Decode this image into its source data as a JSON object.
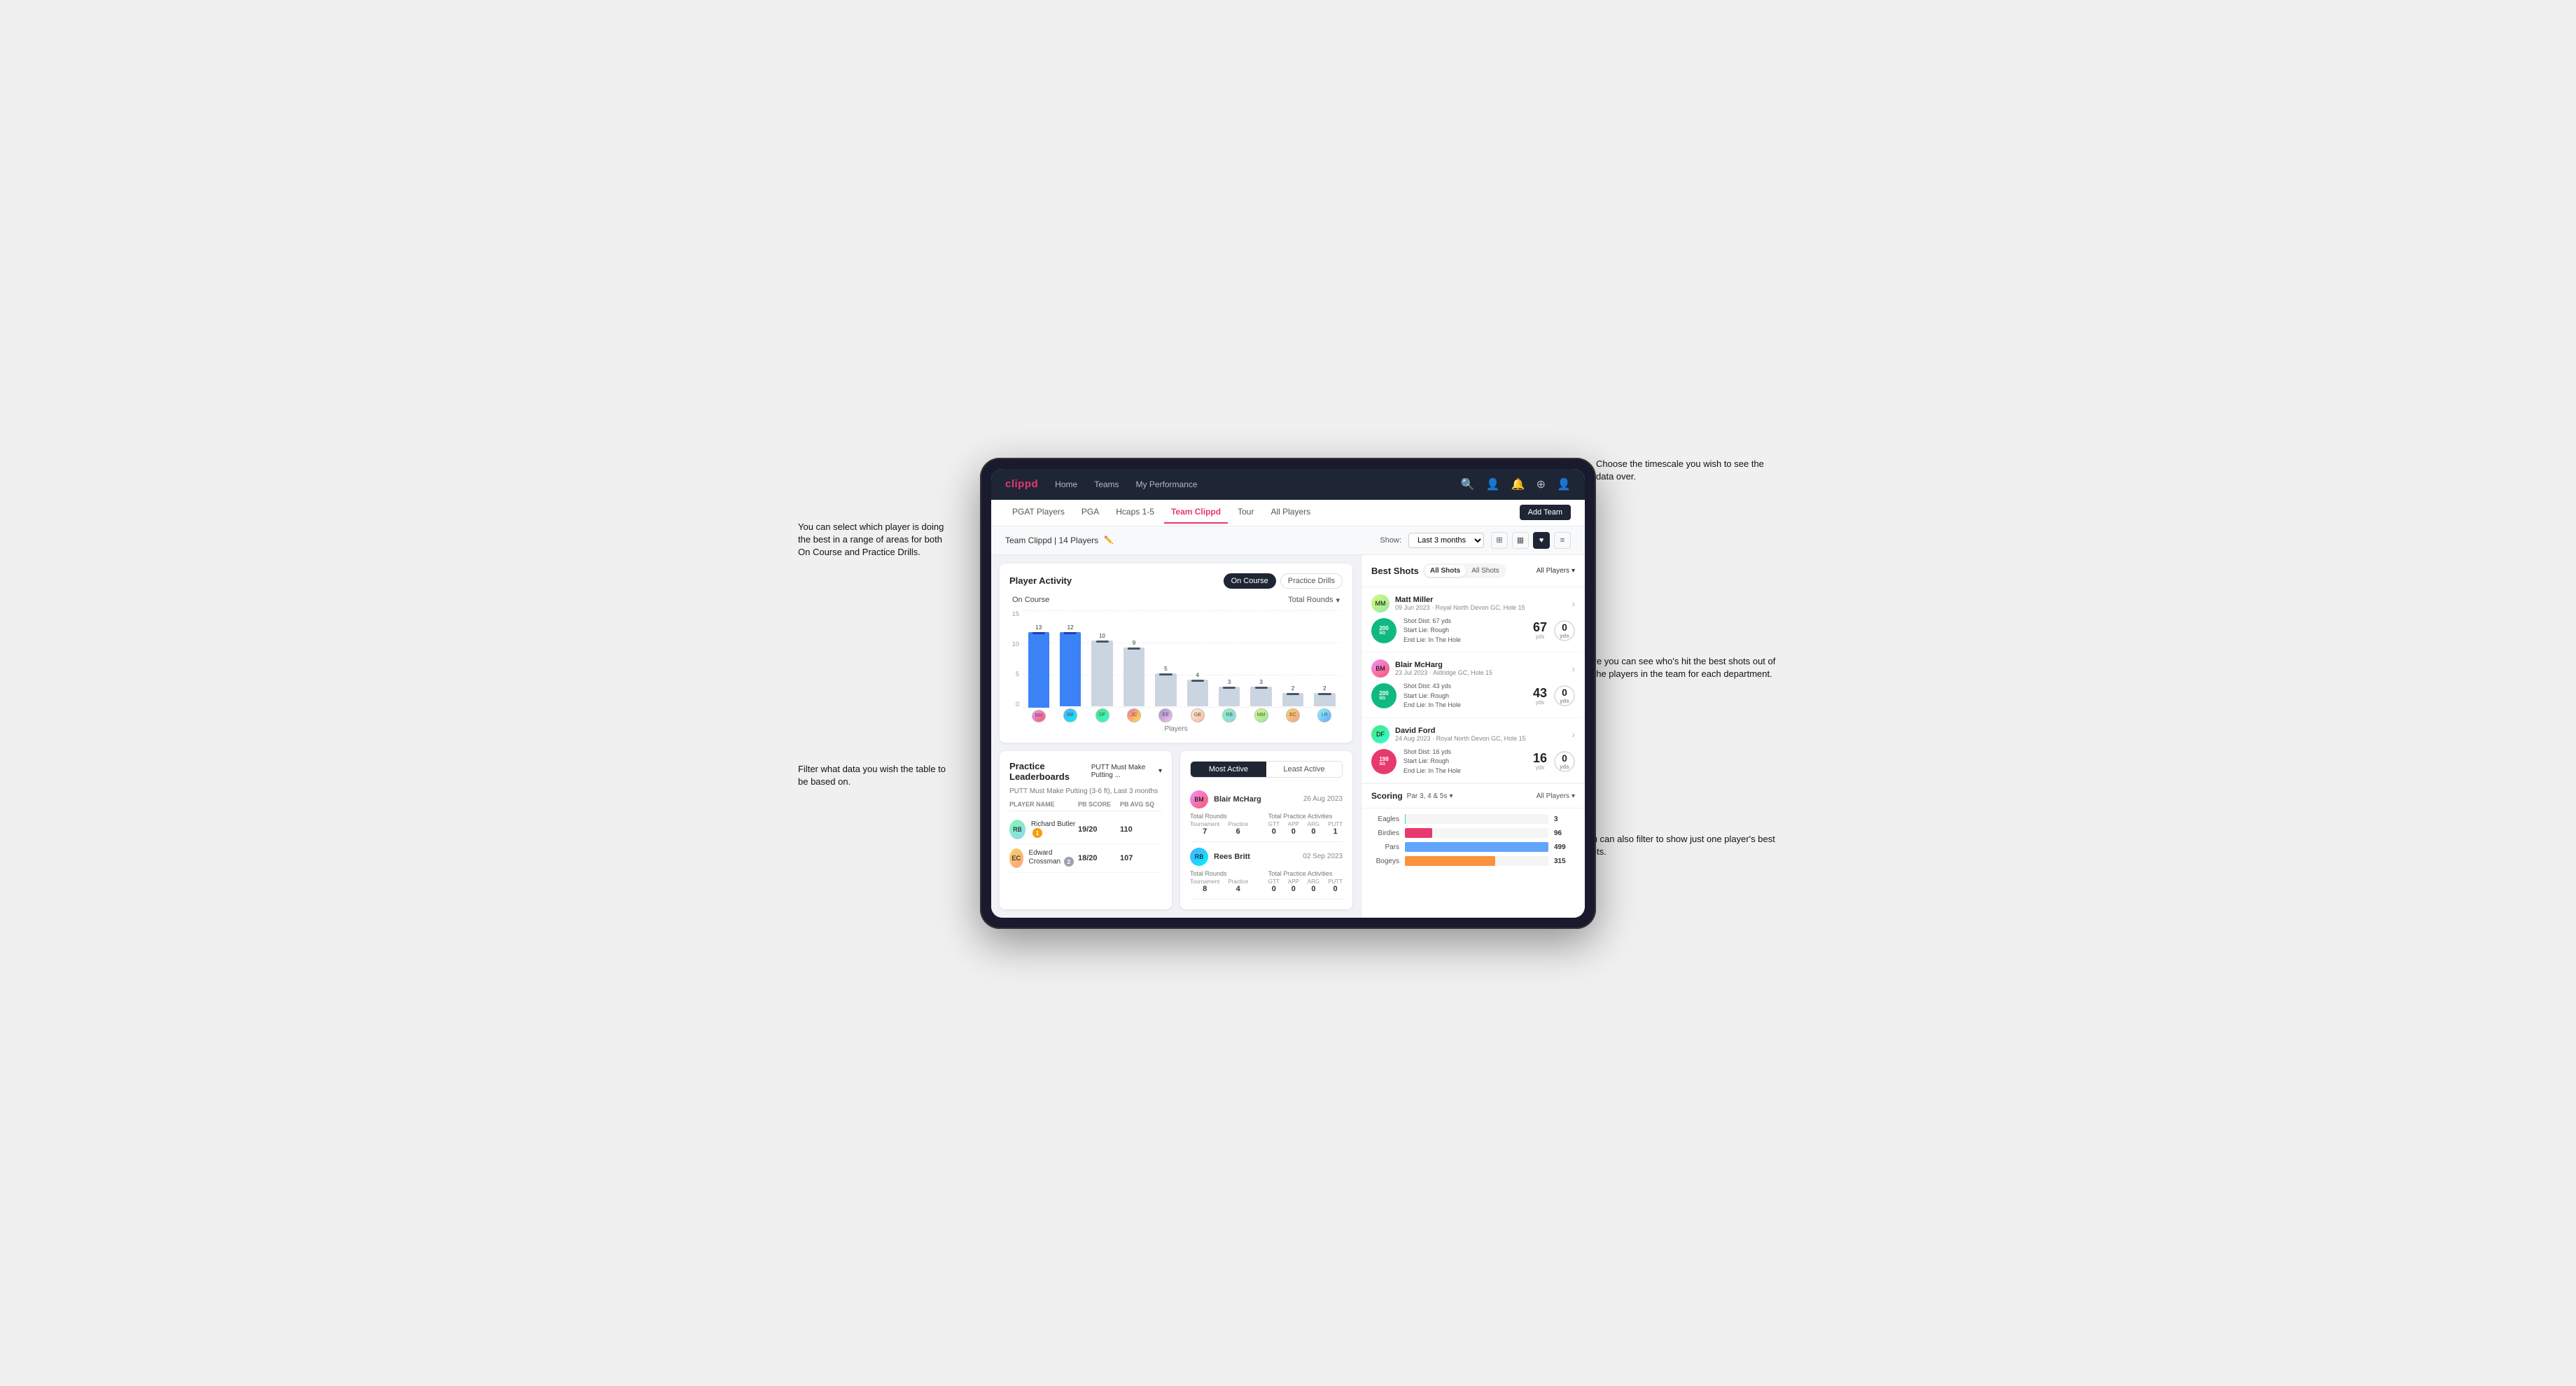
{
  "annotations": {
    "top_right": "Choose the timescale you wish to see the data over.",
    "top_left": "You can select which player is doing the best in a range of areas for both On Course and Practice Drills.",
    "bottom_left": "Filter what data you wish the table to be based on.",
    "mid_right": "Here you can see who's hit the best shots out of all the players in the team for each department.",
    "bottom_right": "You can also filter to show just one player's best shots."
  },
  "nav": {
    "brand": "clippd",
    "items": [
      "Home",
      "Teams",
      "My Performance"
    ]
  },
  "sub_nav": {
    "items": [
      "PGAT Players",
      "PGA",
      "Hcaps 1-5",
      "Team Clippd",
      "Tour",
      "All Players"
    ],
    "active": "Team Clippd",
    "add_button": "Add Team"
  },
  "team_header": {
    "title": "Team Clippd | 14 Players",
    "show_label": "Show:",
    "show_value": "Last 3 months",
    "views": [
      "grid-4",
      "grid-3",
      "heart",
      "list"
    ]
  },
  "player_activity": {
    "title": "Player Activity",
    "tabs": [
      "On Course",
      "Practice Drills"
    ],
    "active_tab": "On Course",
    "chart_label": "On Course",
    "filter_label": "Total Rounds",
    "y_axis_label": "Total Rounds",
    "y_labels": [
      "15",
      "10",
      "5",
      "0"
    ],
    "bars": [
      {
        "name": "B. McHarg",
        "value": 13,
        "pct": 87,
        "avatar": "1"
      },
      {
        "name": "B. Britt",
        "value": 12,
        "pct": 80,
        "avatar": "2"
      },
      {
        "name": "D. Ford",
        "value": 10,
        "pct": 67,
        "avatar": "3"
      },
      {
        "name": "J. Coles",
        "value": 9,
        "pct": 60,
        "avatar": "4"
      },
      {
        "name": "E. Ebert",
        "value": 5,
        "pct": 33,
        "avatar": "5"
      },
      {
        "name": "G. Billingham",
        "value": 4,
        "pct": 27,
        "avatar": "6"
      },
      {
        "name": "R. Butler",
        "value": 3,
        "pct": 20,
        "avatar": "7"
      },
      {
        "name": "M. Miller",
        "value": 3,
        "pct": 20,
        "avatar": "8"
      },
      {
        "name": "E. Crossman",
        "value": 2,
        "pct": 13,
        "avatar": "9"
      },
      {
        "name": "L. Robertson",
        "value": 2,
        "pct": 13,
        "avatar": "10"
      }
    ],
    "x_label": "Players"
  },
  "practice_leaderboards": {
    "title": "Practice Leaderboards",
    "filter": "PUTT Must Make Putting ...",
    "subtitle": "PUTT Must Make Putting (3-6 ft), Last 3 months",
    "columns": [
      "Player Name",
      "PB Score",
      "PB Avg SQ"
    ],
    "rows": [
      {
        "name": "Richard Butler",
        "badge": "1",
        "badge_type": "gold",
        "pb_score": "19/20",
        "pb_avg": "110"
      },
      {
        "name": "Edward Crossman",
        "badge": "2",
        "badge_type": "silver",
        "pb_score": "18/20",
        "pb_avg": "107"
      }
    ]
  },
  "most_active": {
    "tabs": [
      "Most Active",
      "Least Active"
    ],
    "active_tab": "Most Active",
    "players": [
      {
        "name": "Blair McHarg",
        "date": "26 Aug 2023",
        "total_rounds_label": "Total Rounds",
        "tournament": "7",
        "practice": "6",
        "total_practice_label": "Total Practice Activities",
        "gtt": "0",
        "app": "0",
        "arg": "0",
        "putt": "1"
      },
      {
        "name": "Rees Britt",
        "date": "02 Sep 2023",
        "total_rounds_label": "Total Rounds",
        "tournament": "8",
        "practice": "4",
        "total_practice_label": "Total Practice Activities",
        "gtt": "0",
        "app": "0",
        "arg": "0",
        "putt": "0"
      }
    ]
  },
  "best_shots": {
    "title": "Best Shots",
    "toggles": [
      "All Shots",
      "All Shots"
    ],
    "active_toggle": "All Shots",
    "players_label": "All Players",
    "shots": [
      {
        "player": "Matt Miller",
        "date": "09 Jun 2023",
        "course": "Royal North Devon GC",
        "hole": "Hole 15",
        "badge": "200",
        "badge_class": "green",
        "description": "Shot Dist: 67 yds\nStart Lie: Rough\nEnd Lie: In The Hole",
        "distance": "67",
        "dist_unit": "yds",
        "carry": "0",
        "carry_unit": "yds"
      },
      {
        "player": "Blair McHarg",
        "date": "23 Jul 2023",
        "course": "Aldridge GC",
        "hole": "Hole 15",
        "badge": "200",
        "badge_class": "green",
        "description": "Shot Dist: 43 yds\nStart Lie: Rough\nEnd Lie: In The Hole",
        "distance": "43",
        "dist_unit": "yds",
        "carry": "0",
        "carry_unit": "yds"
      },
      {
        "player": "David Ford",
        "date": "24 Aug 2023",
        "course": "Royal North Devon GC",
        "hole": "Hole 15",
        "badge": "198",
        "badge_class": "green",
        "description": "Shot Dist: 16 yds\nStart Lie: Rough\nEnd Lie: In The Hole",
        "distance": "16",
        "dist_unit": "yds",
        "carry": "0",
        "carry_unit": "yds"
      }
    ]
  },
  "scoring": {
    "title": "Scoring",
    "filter1": "Par 3, 4 & 5s",
    "filter2": "All Players",
    "rows": [
      {
        "label": "Eagles",
        "value": 3,
        "max": 500,
        "bar_class": "bar-eagles",
        "pct": 0.6
      },
      {
        "label": "Birdies",
        "value": 96,
        "max": 500,
        "bar_class": "bar-birdies",
        "pct": 19
      },
      {
        "label": "Pars",
        "value": 499,
        "max": 500,
        "bar_class": "bar-pars",
        "pct": 99.8
      },
      {
        "label": "Bogeys",
        "value": 315,
        "max": 500,
        "bar_class": "bar-bogeys",
        "pct": 63
      }
    ]
  }
}
